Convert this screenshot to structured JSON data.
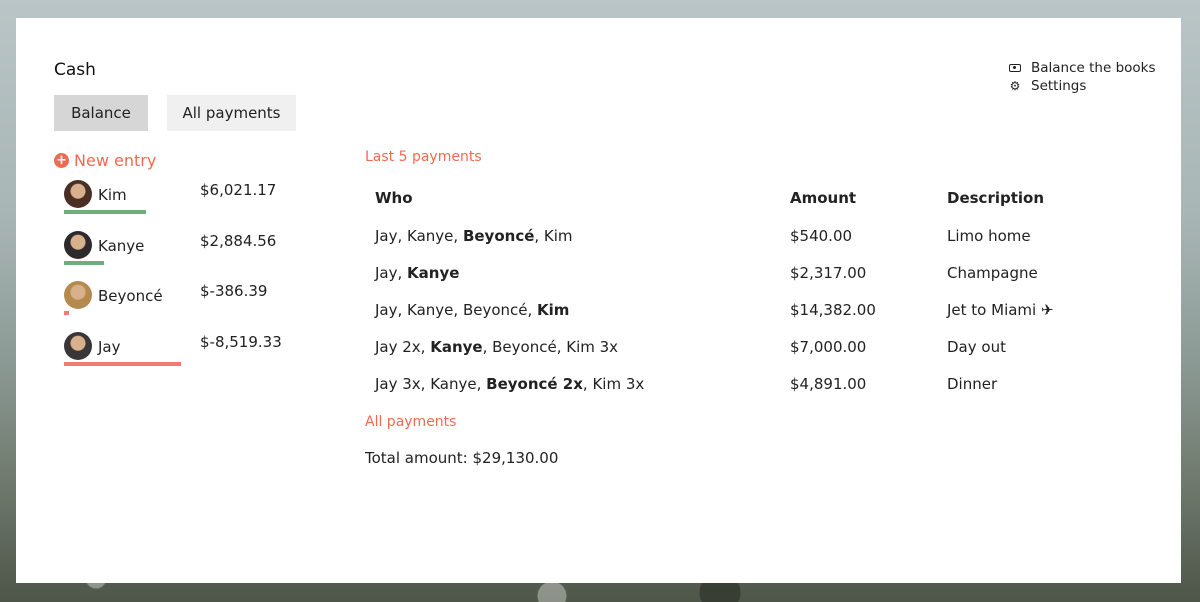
{
  "page": {
    "title": "Cash"
  },
  "tabs": [
    {
      "label": "Balance"
    },
    {
      "label": "All payments"
    }
  ],
  "links": [
    {
      "label": "Balance the books",
      "icon": "cash-icon"
    },
    {
      "label": "Settings",
      "icon": "gear-icon"
    }
  ],
  "new_entry": {
    "label": "New entry",
    "icon": "plus-circle-icon"
  },
  "people": [
    {
      "name": "Kim",
      "amount": "$6,021.17",
      "bar_fraction": 0.7,
      "bar_color": "#6fad7a",
      "avatar_color": "#4a2f25"
    },
    {
      "name": "Kanye",
      "amount": "$2,884.56",
      "bar_fraction": 0.34,
      "bar_color": "#6fad7a",
      "avatar_color": "#2d2a2b"
    },
    {
      "name": "Beyoncé",
      "amount": "$-386.39",
      "bar_fraction": 0.045,
      "bar_color": "#f07b74",
      "avatar_color": "#b58a4f"
    },
    {
      "name": "Jay",
      "amount": "$-8,519.33",
      "bar_fraction": 1.0,
      "bar_color": "#f07b74",
      "avatar_color": "#3a3638"
    }
  ],
  "last_payments": {
    "heading": "Last 5 payments",
    "columns": [
      "Who",
      "Amount",
      "Description"
    ],
    "rows": [
      {
        "who": [
          {
            "t": "Jay, Kanye, "
          },
          {
            "t": "Beyoncé",
            "b": true
          },
          {
            "t": ", Kim"
          }
        ],
        "amount": "$540.00",
        "description": "Limo home"
      },
      {
        "who": [
          {
            "t": "Jay, "
          },
          {
            "t": "Kanye",
            "b": true
          }
        ],
        "amount": "$2,317.00",
        "description": "Champagne"
      },
      {
        "who": [
          {
            "t": "Jay, Kanye, Beyoncé, "
          },
          {
            "t": "Kim",
            "b": true
          }
        ],
        "amount": "$14,382.00",
        "description": "Jet to Miami ✈"
      },
      {
        "who": [
          {
            "t": "Jay 2x, "
          },
          {
            "t": "Kanye",
            "b": true
          },
          {
            "t": ", Beyoncé, Kim 3x"
          }
        ],
        "amount": "$7,000.00",
        "description": "Day out"
      },
      {
        "who": [
          {
            "t": "Jay 3x, Kanye, "
          },
          {
            "t": "Beyoncé 2x",
            "b": true
          },
          {
            "t": ", Kim 3x"
          }
        ],
        "amount": "$4,891.00",
        "description": "Dinner"
      }
    ]
  },
  "all_payments": {
    "heading": "All payments",
    "total": "Total amount: $29,130.00"
  },
  "colors": {
    "accent": "#ef6b50",
    "positive": "#6fad7a",
    "negative": "#f07b74"
  }
}
